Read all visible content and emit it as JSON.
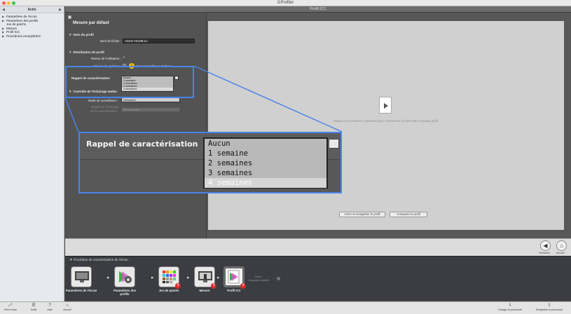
{
  "window": {
    "title": "i1Profiler"
  },
  "sidebar": {
    "header": "Activ",
    "items": [
      {
        "label": "Paramètres de l'écran",
        "arrow": "▶"
      },
      {
        "label": "Paramètres des profils",
        "arrow": "▶"
      },
      {
        "label": "Jeu de patchs",
        "arrow": ""
      },
      {
        "label": "Mesure",
        "arrow": "▶"
      },
      {
        "label": "Profil ICC",
        "arrow": "▶"
      },
      {
        "label": "Procédures enregistrées",
        "arrow": "▶"
      }
    ]
  },
  "main": {
    "header": "Profil ICC",
    "settings_title": "Mesure par défaut",
    "sections": {
      "profile_name": "Nom du profil",
      "profile_dist": "Distribution de profil",
      "recall": "Rappel de caractérisation",
      "ambient": "Contrôle de l'éclairage ambia"
    },
    "fields": {
      "filename_label": "Nom de fichier :",
      "filename_value": "ASUS VG239.icc",
      "user_level_label": "Niveau de l'utilisateur :",
      "user_level_check": "✓",
      "system_level_label": "Niveau du système :",
      "system_level_note": "Non accessible en écriture",
      "monitor_mode_label": "Mode de surveillance :",
      "monitor_mode_value": "Désactivé",
      "dim_label_1": "Rappel de l'éclairage",
      "dim_label_2": "de la caractérisation :",
      "dim_value": "30 secondes"
    },
    "dropdown_options": [
      "Aucun",
      "1 semaine",
      "2 semaines",
      "3 semaines",
      "4 semaines"
    ],
    "dropdown_selected": "4 semaines",
    "canvas_hint": "Cliquez sur le bouton ci-dessous pour commencer à créer votre nouveau profil.",
    "canvas_buttons": {
      "save": "Créer et enregistrer le profil",
      "compare": "Comparer le profil"
    }
  },
  "zoom": {
    "label": "Rappel de caractérisation",
    "options": [
      "Aucun",
      "1 semaine",
      "2 semaines",
      "3 semaines",
      "4 semaines"
    ]
  },
  "nav": {
    "back_label": "Précédent",
    "home_label": "Accueil"
  },
  "procedure": {
    "title": "Procédure de caractérisation de l'écran",
    "steps": [
      {
        "label": "Paramètres de l'écran",
        "icon": "monitor-icon",
        "badge": ""
      },
      {
        "label": "Paramètres des profils",
        "icon": "gear-icon",
        "badge": ""
      },
      {
        "label": "Jeu de patchs",
        "icon": "patch-set-icon",
        "badge": "?"
      },
      {
        "label": "Mesure",
        "icon": "measure-icon",
        "badge": "?"
      },
      {
        "label": "Profil ICC",
        "icon": "icc-profile-icon",
        "badge": "?"
      }
    ],
    "extra_1": "Écran",
    "extra_2": "Assurance qualité"
  },
  "bottombar": {
    "left": [
      {
        "label": "Plein écran",
        "icon": "fullscreen-icon"
      },
      {
        "label": "Actifs",
        "icon": "list-icon"
      },
      {
        "label": "Aide",
        "icon": "help-icon"
      },
      {
        "label": "Accueil",
        "icon": "home-icon"
      }
    ],
    "right": [
      {
        "label": "Charger la procédure",
        "icon": "load-icon"
      },
      {
        "label": "Enregistrer la procédure",
        "icon": "save-icon"
      }
    ]
  }
}
